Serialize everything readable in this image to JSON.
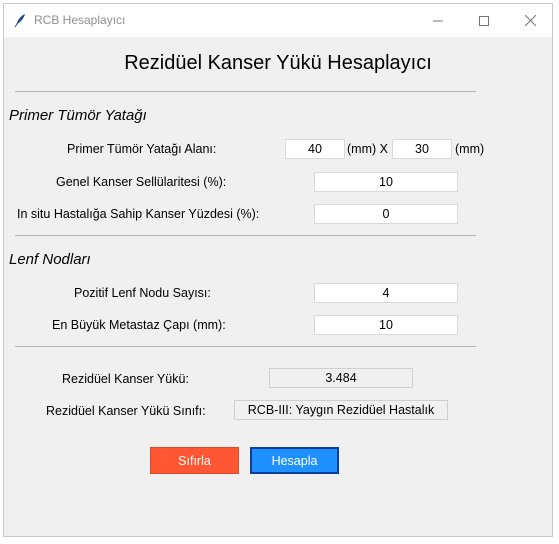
{
  "window": {
    "title": "RCB Hesaplayıcı",
    "icons": {
      "app": "feather-icon",
      "minimize": "minimize-icon",
      "maximize": "maximize-icon",
      "close": "close-icon"
    }
  },
  "heading": "Rezidüel Kanser Yükü Hesaplayıcı",
  "primary_tumor": {
    "section_title": "Primer Tümör Yatağı",
    "area_label": "Primer Tümör Yatağı Alanı:",
    "area_dim1": "40",
    "area_unit1": "(mm) X",
    "area_dim2": "30",
    "area_unit2": "(mm)",
    "cellularity_label": "Genel Kanser Sellülaritesi (%):",
    "cellularity_value": "10",
    "insitu_label": "In situ Hastalığa Sahip Kanser Yüzdesi (%):",
    "insitu_value": "0"
  },
  "lymph_nodes": {
    "section_title": "Lenf Nodları",
    "positive_label": "Pozitif Lenf Nodu Sayısı:",
    "positive_value": "4",
    "metastasis_label": "En Büyük Metastaz Çapı (mm):",
    "metastasis_value": "10"
  },
  "result": {
    "burden_label": "Rezidüel Kanser Yükü:",
    "burden_value": "3.484",
    "class_label": "Rezidüel Kanser Yükü Sınıfı:",
    "class_value": "RCB-III: Yaygın Rezidüel Hastalık"
  },
  "buttons": {
    "reset_label": "Sıfırla",
    "calculate_label": "Hesapla"
  },
  "colors": {
    "reset_button": "#ff5733",
    "calculate_button": "#1e90ff",
    "window_background": "#f0f0f0"
  }
}
